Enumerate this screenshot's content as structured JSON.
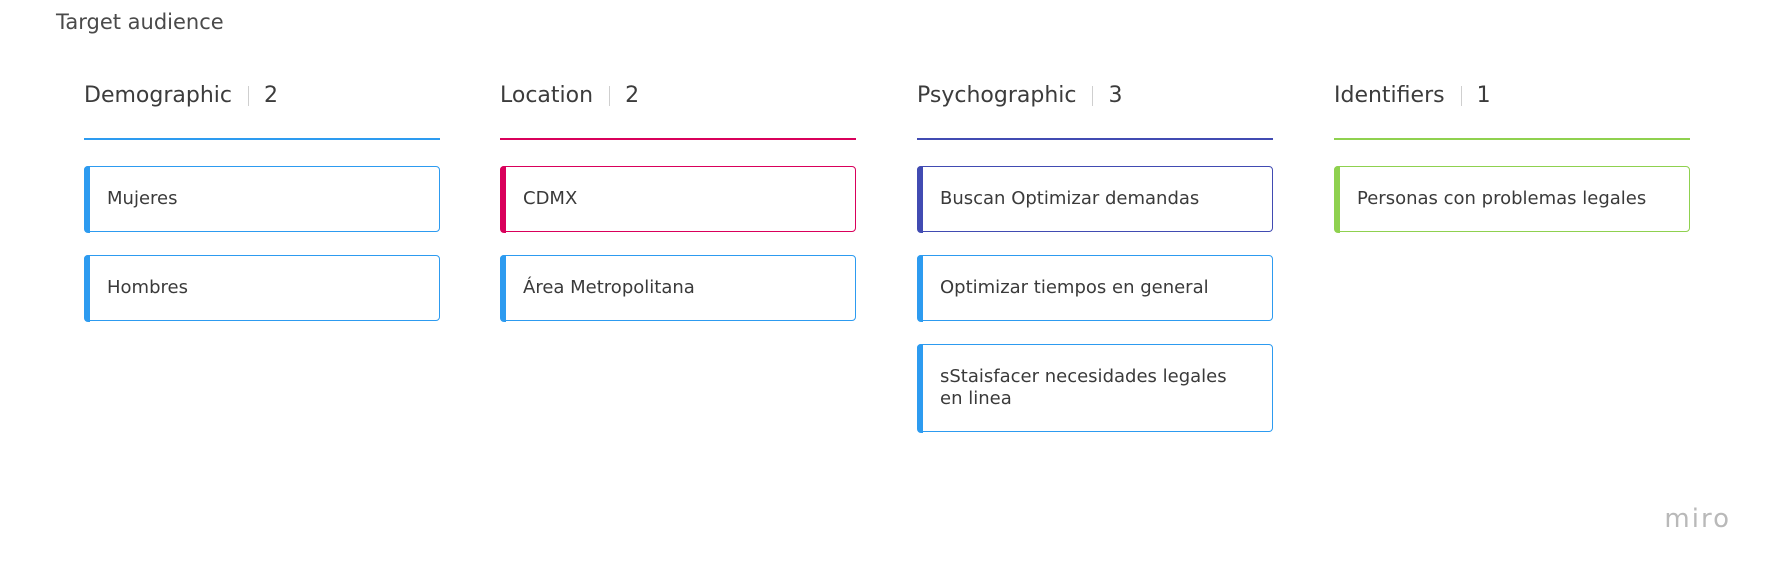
{
  "board": {
    "title": "Target audience",
    "logo_text": "miro"
  },
  "columns": [
    {
      "title": "Demographic",
      "count": "2",
      "accent": "#2d9bf0",
      "cards": [
        {
          "text": "Mujeres",
          "accent": "#2d9bf0"
        },
        {
          "text": "Hombres",
          "accent": "#2d9bf0"
        }
      ]
    },
    {
      "title": "Location",
      "count": "2",
      "accent": "#d9005b",
      "cards": [
        {
          "text": "CDMX",
          "accent": "#d9005b"
        },
        {
          "text": "Área Metropolitana",
          "accent": "#2d9bf0"
        }
      ]
    },
    {
      "title": "Psychographic",
      "count": "3",
      "accent": "#414bb2",
      "cards": [
        {
          "text": "Buscan Optimizar demandas",
          "accent": "#414bb2"
        },
        {
          "text": "Optimizar tiempos en general",
          "accent": "#2d9bf0"
        },
        {
          "text": "sStaisfacer necesidades legales en linea",
          "accent": "#2d9bf0"
        }
      ]
    },
    {
      "title": "Identifiers",
      "count": "1",
      "accent": "#8fd14f",
      "cards": [
        {
          "text": "Personas con problemas legales",
          "accent": "#8fd14f"
        }
      ]
    }
  ]
}
